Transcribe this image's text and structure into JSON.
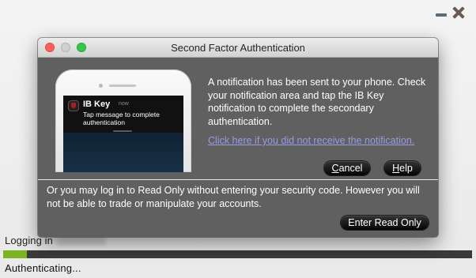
{
  "background_window": {
    "logging_in_label": "Logging in",
    "status_text": "Authenticating...",
    "progress_fraction": 0.05,
    "progress_color": "#7bb321",
    "icons": [
      "minimize-icon",
      "close-icon"
    ]
  },
  "dialog": {
    "title": "Second Factor Authentication",
    "window_buttons": [
      "close",
      "minimize",
      "zoom"
    ],
    "phone_notification": {
      "app_name": "IB Key",
      "time": "now",
      "message": "Tap message to complete authentication"
    },
    "message": "A notification has been sent to your phone. Check your notification area and tap the IB Key notification to complete the secondary authentication.",
    "resend_link": "Click here if you did not receive the notification.",
    "cancel_button": {
      "prefix": "",
      "mnemonic": "C",
      "rest": "ancel"
    },
    "help_button": {
      "prefix": "",
      "mnemonic": "H",
      "rest": "elp"
    },
    "readonly_text": "Or you may log in to Read Only without entering your security code. However you will not be able to trade or manipulate your accounts.",
    "readonly_button": "Enter Read Only"
  },
  "colors": {
    "dialog_bg": "#606060",
    "link": "#9a9ae6",
    "button_bg": "#0a0a0a"
  }
}
